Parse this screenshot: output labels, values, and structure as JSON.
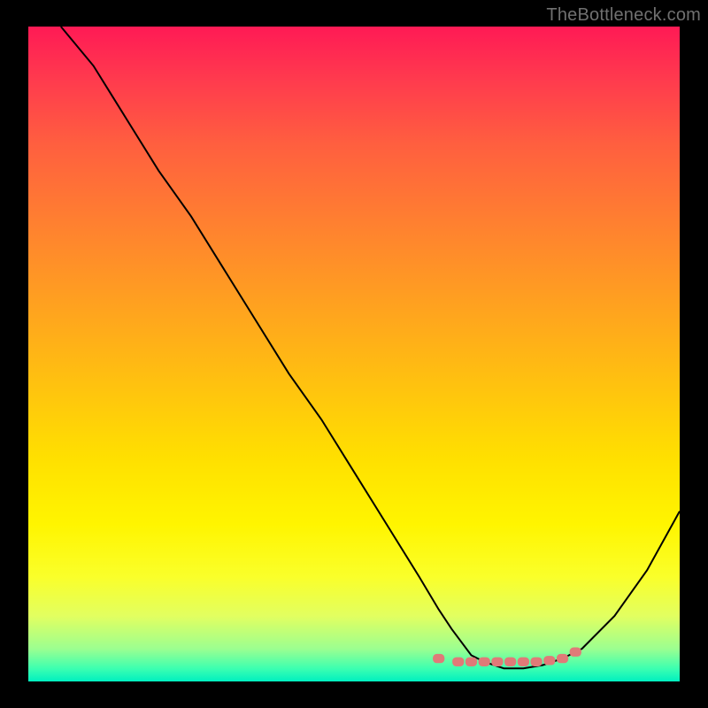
{
  "watermark": "TheBottleneck.com",
  "chart_data": {
    "type": "line",
    "title": "",
    "xlabel": "",
    "ylabel": "",
    "xlim": [
      0,
      100
    ],
    "ylim": [
      0,
      100
    ],
    "series": [
      {
        "name": "curve",
        "x": [
          5,
          10,
          15,
          20,
          25,
          30,
          35,
          40,
          45,
          50,
          55,
          60,
          63,
          65,
          68,
          70,
          73,
          76,
          79,
          82,
          85,
          90,
          95,
          100
        ],
        "values": [
          100,
          94,
          86,
          78,
          71,
          63,
          55,
          47,
          40,
          32,
          24,
          16,
          11,
          8,
          4,
          3,
          2,
          2,
          2.5,
          3.5,
          5,
          10,
          17,
          26
        ]
      }
    ],
    "markers": {
      "name": "highlight-dots",
      "style": "pink-rounded",
      "x_range": [
        63,
        84
      ],
      "x": [
        63,
        66,
        68,
        70,
        72,
        74,
        76,
        78,
        80,
        82,
        84
      ],
      "values": [
        3.5,
        3,
        3,
        3,
        3,
        3,
        3,
        3,
        3.2,
        3.5,
        4.5
      ]
    },
    "background_gradient": {
      "from": "#ff1a55",
      "to": "#00f0c0",
      "direction": "vertical"
    }
  }
}
